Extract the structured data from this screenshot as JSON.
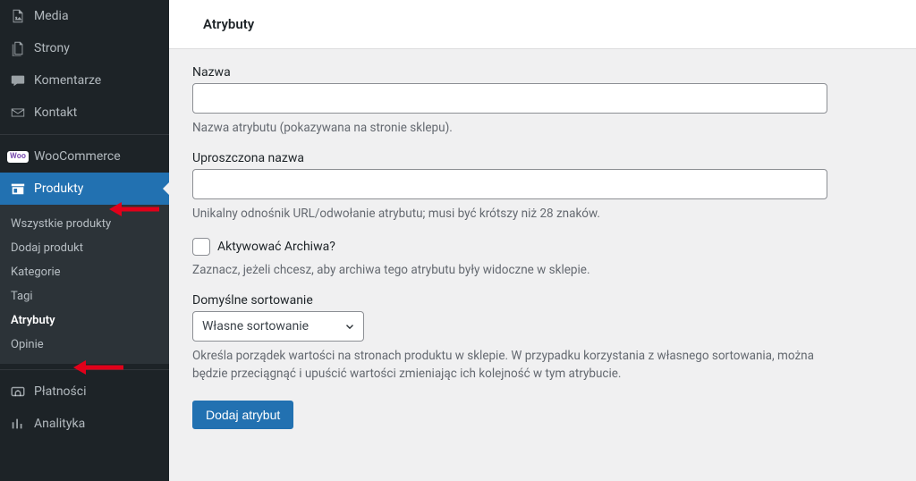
{
  "sidebar": {
    "items": [
      {
        "label": "Media",
        "icon": "media-icon"
      },
      {
        "label": "Strony",
        "icon": "pages-icon"
      },
      {
        "label": "Komentarze",
        "icon": "comments-icon"
      },
      {
        "label": "Kontakt",
        "icon": "mail-icon"
      },
      {
        "label": "WooCommerce",
        "icon": "woo-icon"
      },
      {
        "label": "Produkty",
        "icon": "products-icon"
      },
      {
        "label": "Płatności",
        "icon": "payments-icon"
      },
      {
        "label": "Analityka",
        "icon": "analytics-icon"
      }
    ],
    "submenu": [
      "Wszystkie produkty",
      "Dodaj produkt",
      "Kategorie",
      "Tagi",
      "Atrybuty",
      "Opinie"
    ]
  },
  "page": {
    "title": "Atrybuty",
    "name_label": "Nazwa",
    "name_help": "Nazwa atrybutu (pokazywana na stronie sklepu).",
    "slug_label": "Uproszczona nazwa",
    "slug_help": "Unikalny odnośnik URL/odwołanie atrybutu; musi być krótszy niż 28 znaków.",
    "archive_label": "Aktywować Archiwa?",
    "archive_help": "Zaznacz, jeżeli chcesz, aby archiwa tego atrybutu były widoczne w sklepie.",
    "sort_label": "Domyślne sortowanie",
    "sort_selected": "Własne sortowanie",
    "sort_help": "Określa porządek wartości na stronach produktu w sklepie. W przypadku korzystania z własnego sortowania, można będzie przeciągnąć i upuścić wartości zmieniając ich kolejność w tym atrybucie.",
    "submit": "Dodaj atrybut"
  }
}
